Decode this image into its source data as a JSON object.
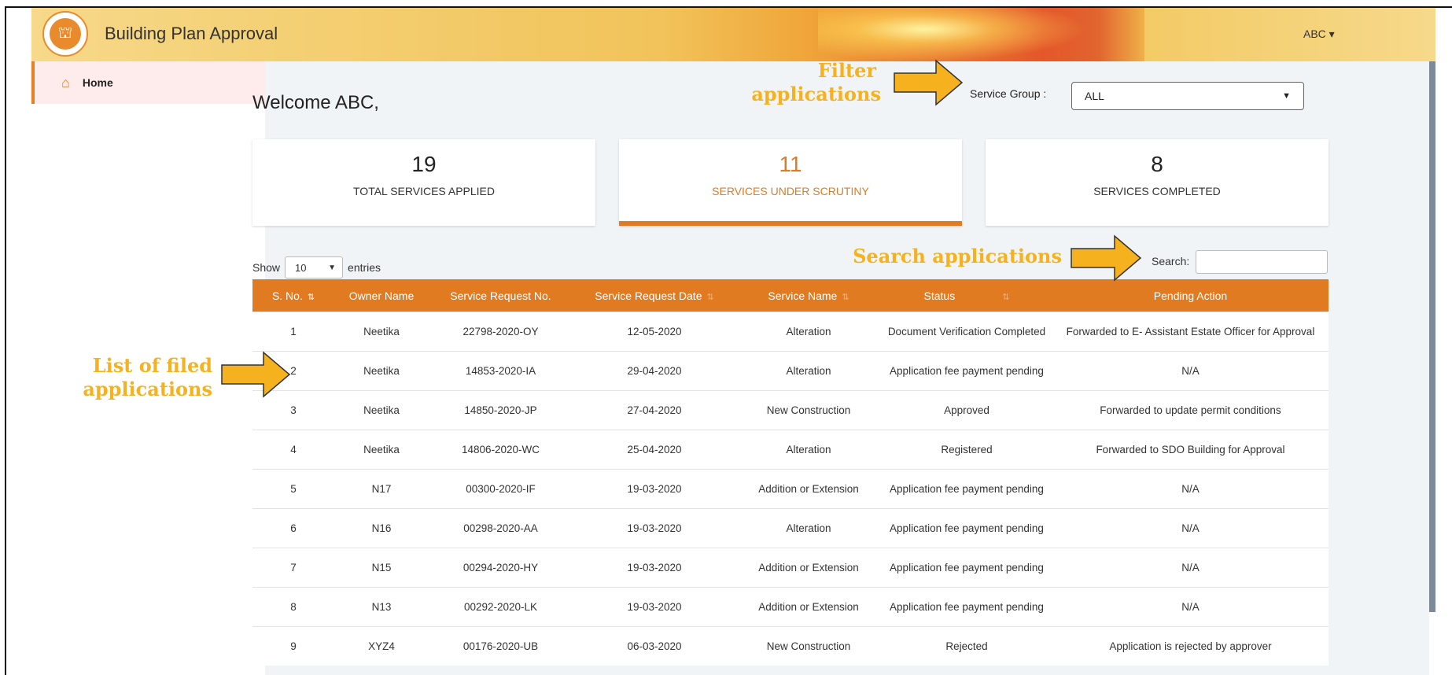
{
  "header": {
    "app_title": "Building Plan Approval",
    "user_menu": "ABC ▾"
  },
  "sidebar": {
    "items": [
      {
        "label": "Home",
        "icon": "home-icon"
      }
    ]
  },
  "main": {
    "welcome": "Welcome ABC,",
    "service_group": {
      "label": "Service Group :",
      "value": "ALL"
    },
    "cards": [
      {
        "value": "19",
        "label": "TOTAL SERVICES APPLIED"
      },
      {
        "value": "11",
        "label": "SERVICES UNDER SCRUTINY"
      },
      {
        "value": "8",
        "label": "SERVICES COMPLETED"
      }
    ],
    "table_controls": {
      "show": "Show",
      "entries_value": "10",
      "entries": "entries",
      "search_label": "Search:"
    },
    "table": {
      "columns": [
        "S. No.",
        "Owner Name",
        "Service Request No.",
        "Service Request Date",
        "Service Name",
        "Status",
        "Pending Action"
      ],
      "rows": [
        [
          "1",
          "Neetika",
          "22798-2020-OY",
          "12-05-2020",
          "Alteration",
          "Document Verification Completed",
          "Forwarded to E- Assistant Estate Officer for Approval"
        ],
        [
          "2",
          "Neetika",
          "14853-2020-IA",
          "29-04-2020",
          "Alteration",
          "Application fee payment pending",
          "N/A"
        ],
        [
          "3",
          "Neetika",
          "14850-2020-JP",
          "27-04-2020",
          "New Construction",
          "Approved",
          "Forwarded to update permit conditions"
        ],
        [
          "4",
          "Neetika",
          "14806-2020-WC",
          "25-04-2020",
          "Alteration",
          "Registered",
          "Forwarded to SDO Building for Approval"
        ],
        [
          "5",
          "N17",
          "00300-2020-IF",
          "19-03-2020",
          "Addition or Extension",
          "Application fee payment pending",
          "N/A"
        ],
        [
          "6",
          "N16",
          "00298-2020-AA",
          "19-03-2020",
          "Alteration",
          "Application fee payment pending",
          "N/A"
        ],
        [
          "7",
          "N15",
          "00294-2020-HY",
          "19-03-2020",
          "Addition or Extension",
          "Application fee payment pending",
          "N/A"
        ],
        [
          "8",
          "N13",
          "00292-2020-LK",
          "19-03-2020",
          "Addition or Extension",
          "Application fee payment pending",
          "N/A"
        ],
        [
          "9",
          "XYZ4",
          "00176-2020-UB",
          "06-03-2020",
          "New Construction",
          "Rejected",
          "Application is rejected by approver"
        ]
      ]
    }
  },
  "annotations": {
    "filter_line1": "Filter",
    "filter_line2": "applications",
    "search": "Search applications",
    "list_line1": "List of filed",
    "list_line2": "applications"
  },
  "colors": {
    "accent": "#e07b22",
    "annotation": "#f5b21e"
  }
}
